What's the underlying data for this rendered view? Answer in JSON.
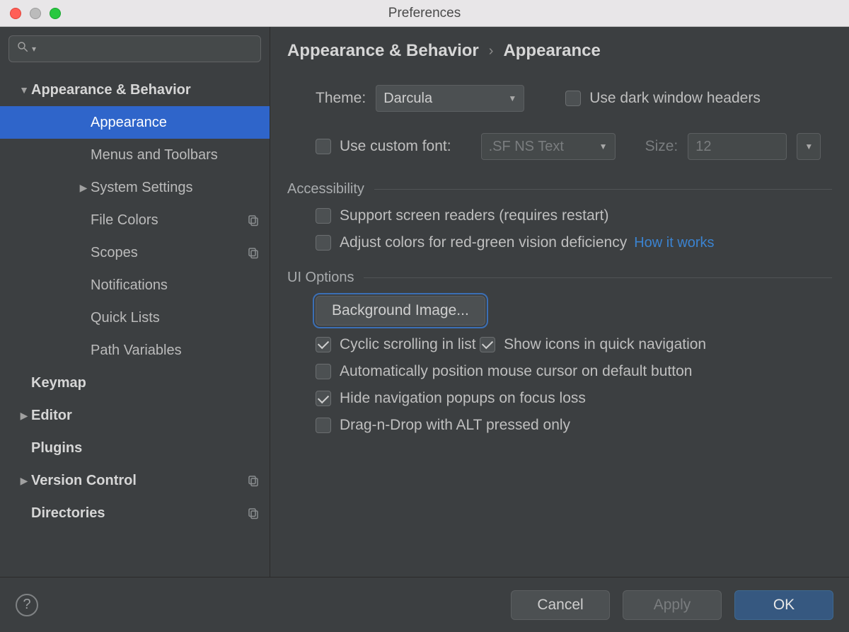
{
  "window": {
    "title": "Preferences"
  },
  "search": {
    "placeholder": ""
  },
  "tree": [
    {
      "label": "Appearance & Behavior",
      "depth": 0,
      "bold": true,
      "arrow": "down",
      "selected": false,
      "badge": false
    },
    {
      "label": "Appearance",
      "depth": 1,
      "bold": false,
      "arrow": "none",
      "selected": true,
      "badge": false
    },
    {
      "label": "Menus and Toolbars",
      "depth": 1,
      "bold": false,
      "arrow": "none",
      "selected": false,
      "badge": false
    },
    {
      "label": "System Settings",
      "depth": 1,
      "bold": false,
      "arrow": "right",
      "selected": false,
      "badge": false
    },
    {
      "label": "File Colors",
      "depth": 1,
      "bold": false,
      "arrow": "none",
      "selected": false,
      "badge": true
    },
    {
      "label": "Scopes",
      "depth": 1,
      "bold": false,
      "arrow": "none",
      "selected": false,
      "badge": true
    },
    {
      "label": "Notifications",
      "depth": 1,
      "bold": false,
      "arrow": "none",
      "selected": false,
      "badge": false
    },
    {
      "label": "Quick Lists",
      "depth": 1,
      "bold": false,
      "arrow": "none",
      "selected": false,
      "badge": false
    },
    {
      "label": "Path Variables",
      "depth": 1,
      "bold": false,
      "arrow": "none",
      "selected": false,
      "badge": false
    },
    {
      "label": "Keymap",
      "depth": 0,
      "bold": true,
      "arrow": "none",
      "selected": false,
      "badge": false
    },
    {
      "label": "Editor",
      "depth": 0,
      "bold": true,
      "arrow": "right",
      "selected": false,
      "badge": false
    },
    {
      "label": "Plugins",
      "depth": 0,
      "bold": true,
      "arrow": "none",
      "selected": false,
      "badge": false
    },
    {
      "label": "Version Control",
      "depth": 0,
      "bold": true,
      "arrow": "right",
      "selected": false,
      "badge": true
    },
    {
      "label": "Directories",
      "depth": 0,
      "bold": true,
      "arrow": "none",
      "selected": false,
      "badge": true
    }
  ],
  "breadcrumb": {
    "a": "Appearance & Behavior",
    "sep": "›",
    "b": "Appearance"
  },
  "theme": {
    "label": "Theme:",
    "value": "Darcula",
    "darkHeaders": "Use dark window headers"
  },
  "font": {
    "use": "Use custom font:",
    "name": ".SF NS Text",
    "sizeLabel": "Size:",
    "size": "12"
  },
  "accessibility": {
    "title": "Accessibility",
    "screenReaders": "Support screen readers (requires restart)",
    "colorDeficiency": "Adjust colors for red-green vision deficiency",
    "howItWorks": "How it works"
  },
  "uiOptions": {
    "title": "UI Options",
    "bgImage": "Background Image...",
    "cyclic": "Cyclic scrolling in list",
    "quickNavIcons": "Show icons in quick navigation",
    "autoCursor": "Automatically position mouse cursor on default button",
    "hidePopups": "Hide navigation popups on focus loss",
    "dndAlt": "Drag-n-Drop with ALT pressed only"
  },
  "footer": {
    "cancel": "Cancel",
    "apply": "Apply",
    "ok": "OK"
  }
}
